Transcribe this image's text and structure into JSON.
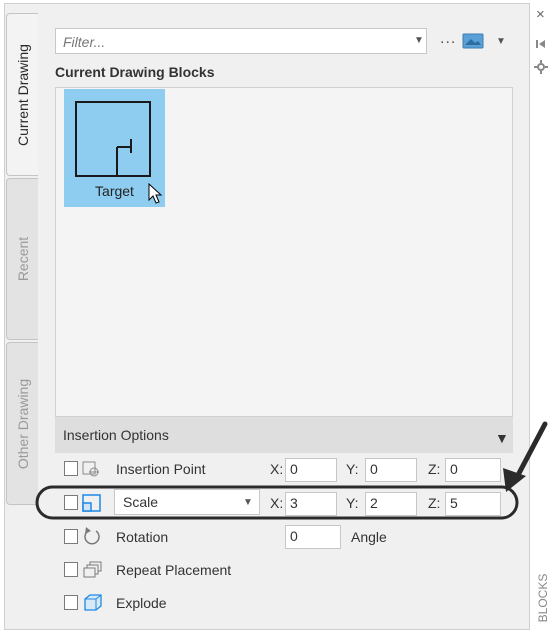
{
  "tabs": [
    {
      "label": "Current Drawing",
      "active": true
    },
    {
      "label": "Recent",
      "active": false
    },
    {
      "label": "Other Drawing",
      "active": false
    }
  ],
  "filter": {
    "placeholder": "Filter..."
  },
  "toolbar": {
    "more_label": "...",
    "view_icon": "thumbnail-view-icon"
  },
  "side_buttons": {
    "close": "×",
    "autohide": "auto-hide-icon",
    "settings": "settings-icon"
  },
  "palette_title": "BLOCKS",
  "section_title": "Current Drawing Blocks",
  "blocks": [
    {
      "name": "Target",
      "selected": true
    }
  ],
  "insertion_options": {
    "title": "Insertion Options",
    "rows": {
      "insertion_point": {
        "label": "Insertion Point",
        "x_label": "X:",
        "x": "0",
        "y_label": "Y:",
        "y": "0",
        "z_label": "Z:",
        "z": "0"
      },
      "scale": {
        "label": "Scale",
        "x_label": "X:",
        "x": "3",
        "y_label": "Y:",
        "y": "2",
        "z_label": "Z:",
        "z": "5"
      },
      "rotation": {
        "label": "Rotation",
        "value": "0",
        "unit_label": "Angle"
      },
      "repeat_placement": {
        "label": "Repeat Placement"
      },
      "explode": {
        "label": "Explode"
      }
    }
  },
  "colors": {
    "selection": "#8fcdf0",
    "annotation": "#2b2b2b",
    "accent": "#1e88e5"
  }
}
